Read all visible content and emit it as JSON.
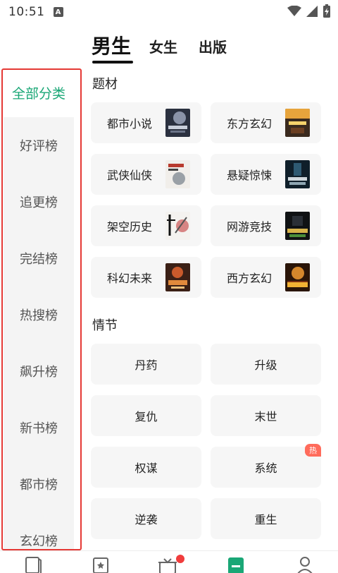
{
  "status_bar": {
    "time": "10:51",
    "badge": "A"
  },
  "top_tabs": [
    {
      "label": "男生",
      "active": true
    },
    {
      "label": "女生",
      "active": false
    },
    {
      "label": "出版",
      "active": false
    }
  ],
  "sidebar": {
    "items": [
      {
        "label": "全部分类",
        "active": true
      },
      {
        "label": "好评榜"
      },
      {
        "label": "追更榜"
      },
      {
        "label": "完结榜"
      },
      {
        "label": "热搜榜"
      },
      {
        "label": "飙升榜"
      },
      {
        "label": "新书榜"
      },
      {
        "label": "都市榜"
      },
      {
        "label": "玄幻榜"
      }
    ]
  },
  "genres": {
    "title": "题材",
    "items": [
      {
        "label": "都市小说",
        "cover": "book-cover-icon"
      },
      {
        "label": "东方玄幻",
        "cover": "book-cover-icon"
      },
      {
        "label": "武侠仙侠",
        "cover": "book-cover-icon"
      },
      {
        "label": "悬疑惊悚",
        "cover": "book-cover-icon"
      },
      {
        "label": "架空历史",
        "cover": "book-cover-icon"
      },
      {
        "label": "网游竞技",
        "cover": "book-cover-icon"
      },
      {
        "label": "科幻未来",
        "cover": "book-cover-icon"
      },
      {
        "label": "西方玄幻",
        "cover": "book-cover-icon"
      }
    ]
  },
  "plots": {
    "title": "情节",
    "items": [
      {
        "label": "丹药"
      },
      {
        "label": "升级"
      },
      {
        "label": "复仇"
      },
      {
        "label": "末世"
      },
      {
        "label": "权谋"
      },
      {
        "label": "系统",
        "badge": "热"
      },
      {
        "label": "逆袭"
      },
      {
        "label": "重生"
      }
    ]
  },
  "colors": {
    "accent_green": "#1aa776",
    "highlight_red": "#e53935",
    "hot_badge": "#ff6b5b",
    "card_bg": "#f6f6f6",
    "sidebar_bg": "#f4f4f4"
  }
}
